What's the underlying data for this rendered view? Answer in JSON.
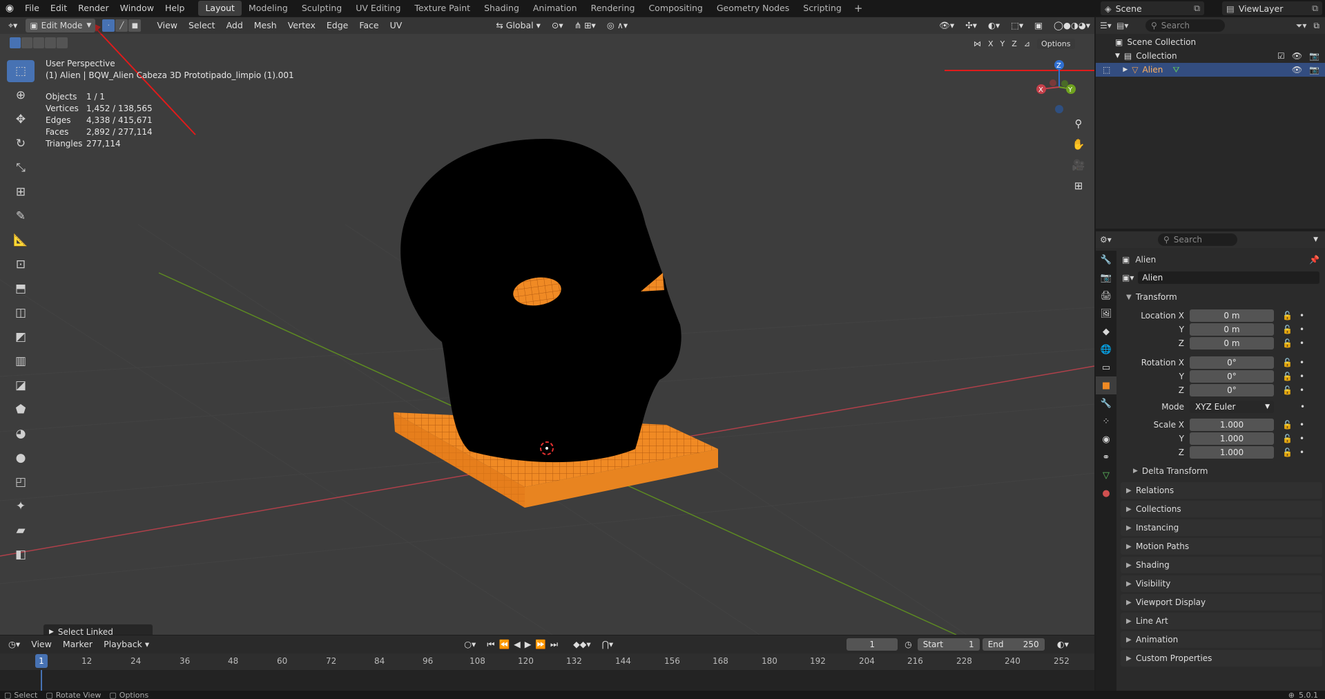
{
  "topbar": {
    "menus": [
      "File",
      "Edit",
      "Render",
      "Window",
      "Help"
    ],
    "tabs": [
      "Layout",
      "Modeling",
      "Sculpting",
      "UV Editing",
      "Texture Paint",
      "Shading",
      "Animation",
      "Rendering",
      "Compositing",
      "Geometry Nodes",
      "Scripting"
    ],
    "active_tab": "Layout",
    "add_tab": "+",
    "scene": "Scene",
    "view_layer": "ViewLayer"
  },
  "viewport": {
    "mode": "Edit Mode",
    "menus": [
      "View",
      "Select",
      "Add",
      "Mesh",
      "Vertex",
      "Edge",
      "Face",
      "UV"
    ],
    "orientation": "Global",
    "axes": [
      "X",
      "Y",
      "Z"
    ],
    "options": "Options",
    "perspective": "User Perspective",
    "object_label": "(1) Alien | BQW_Alien Cabeza 3D Prototipado_limpio (1).001",
    "stats": [
      {
        "k": "Objects",
        "v": "1 / 1"
      },
      {
        "k": "Vertices",
        "v": "1,452 / 138,565"
      },
      {
        "k": "Edges",
        "v": "4,338 / 415,671"
      },
      {
        "k": "Faces",
        "v": "2,892 / 277,114"
      },
      {
        "k": "Triangles",
        "v": "277,114"
      }
    ],
    "gizmo": {
      "x": "X",
      "y": "Y",
      "z": "Z"
    },
    "last_operator": "Select Linked"
  },
  "outliner": {
    "search_placeholder": "Search",
    "scene_collection": "Scene Collection",
    "collection": "Collection",
    "object": "Alien"
  },
  "properties": {
    "search_placeholder": "Search",
    "object_name": "Alien",
    "data_name": "Alien",
    "transform": "Transform",
    "location_label": "Location X",
    "rotation_label": "Rotation X",
    "scale_label": "Scale X",
    "y": "Y",
    "z": "Z",
    "location": [
      "0 m",
      "0 m",
      "0 m"
    ],
    "rotation": [
      "0°",
      "0°",
      "0°"
    ],
    "mode_label": "Mode",
    "mode_value": "XYZ Euler",
    "scale": [
      "1.000",
      "1.000",
      "1.000"
    ],
    "delta": "Delta Transform",
    "panels": [
      "Relations",
      "Collections",
      "Instancing",
      "Motion Paths",
      "Shading",
      "Visibility",
      "Viewport Display",
      "Line Art",
      "Animation",
      "Custom Properties"
    ]
  },
  "timeline": {
    "menus": [
      "View",
      "Marker",
      "Playback"
    ],
    "current_frame": "1",
    "start_label": "Start",
    "start": "1",
    "end_label": "End",
    "end": "250",
    "ticks": [
      "1",
      "12",
      "24",
      "36",
      "48",
      "60",
      "72",
      "84",
      "96",
      "108",
      "120",
      "132",
      "144",
      "156",
      "168",
      "180",
      "192",
      "204",
      "216",
      "228",
      "240",
      "252"
    ]
  },
  "statusbar": {
    "items": [
      "Select",
      "Rotate View",
      "Options"
    ],
    "version": "5.0.1"
  },
  "colors": {
    "accent": "#4772b3",
    "selected": "#ff8a1c",
    "xaxis": "#c5404a",
    "yaxis": "#6fa21f",
    "zaxis": "#2f6fd1",
    "annotation": "#e01b1b"
  }
}
